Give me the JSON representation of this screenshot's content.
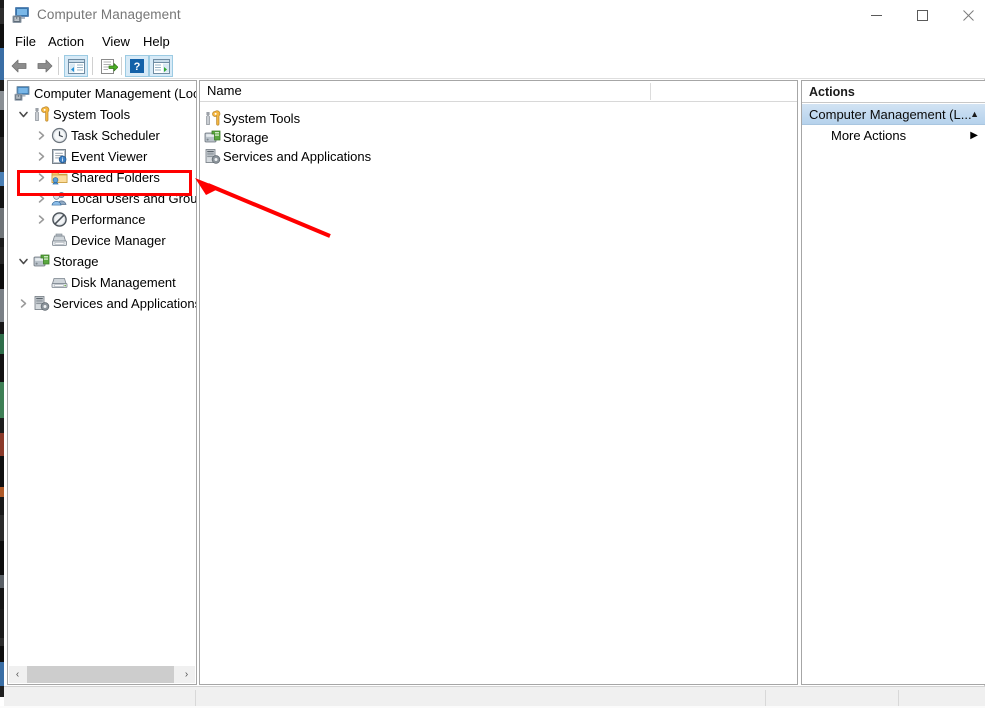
{
  "window": {
    "title": "Computer Management",
    "title_icon": "computer-management-icon",
    "controls": {
      "minimize": "—",
      "maximize": "☐",
      "close": "×"
    }
  },
  "menubar": {
    "items": [
      {
        "label": "File",
        "name": "menu-file"
      },
      {
        "label": "Action",
        "name": "menu-action"
      },
      {
        "label": "View",
        "name": "menu-view"
      },
      {
        "label": "Help",
        "name": "menu-help"
      }
    ]
  },
  "toolbar": {
    "buttons": [
      {
        "name": "back-icon",
        "glyph": "◀"
      },
      {
        "name": "forward-icon",
        "glyph": "▶"
      },
      {
        "name": "show-hide-console-tree-icon",
        "glyph": "tree"
      },
      {
        "name": "export-list-icon",
        "glyph": "export"
      },
      {
        "name": "help-icon",
        "glyph": "?"
      },
      {
        "name": "show-hide-action-pane-icon",
        "glyph": "pane"
      }
    ]
  },
  "tree": {
    "root": {
      "label": "Computer Management (Local",
      "icon": "computer-icon"
    },
    "items": [
      {
        "label": "System Tools",
        "icon": "system-tools-icon",
        "indent": 1,
        "expander": "expanded"
      },
      {
        "label": "Task Scheduler",
        "icon": "clock-icon",
        "indent": 2,
        "expander": "collapsed"
      },
      {
        "label": "Event Viewer",
        "icon": "event-viewer-icon",
        "indent": 2,
        "expander": "collapsed"
      },
      {
        "label": "Shared Folders",
        "icon": "shared-folders-icon",
        "indent": 2,
        "expander": "collapsed"
      },
      {
        "label": "Local Users and Groups",
        "icon": "users-groups-icon",
        "indent": 2,
        "expander": "collapsed"
      },
      {
        "label": "Performance",
        "icon": "performance-icon",
        "indent": 2,
        "expander": "collapsed"
      },
      {
        "label": "Device Manager",
        "icon": "device-manager-icon",
        "indent": 2,
        "expander": "none"
      },
      {
        "label": "Storage",
        "icon": "storage-icon",
        "indent": 1,
        "expander": "expanded"
      },
      {
        "label": "Disk Management",
        "icon": "disk-icon",
        "indent": 2,
        "expander": "none"
      },
      {
        "label": "Services and Applications",
        "icon": "services-icon",
        "indent": 1,
        "expander": "collapsed"
      }
    ],
    "scrollbar": {
      "left_arrow": "‹",
      "right_arrow": "›"
    }
  },
  "list": {
    "columns": [
      {
        "label": "Name"
      }
    ],
    "rows": [
      {
        "label": "System Tools",
        "icon": "system-tools-icon"
      },
      {
        "label": "Storage",
        "icon": "storage-icon"
      },
      {
        "label": "Services and Applications",
        "icon": "services-icon"
      }
    ]
  },
  "actions": {
    "header": "Actions",
    "group": {
      "label": "Computer Management (L...",
      "chevron": "▲"
    },
    "more": {
      "label": "More Actions",
      "arrow": "▶"
    }
  },
  "annotations": {
    "highlight": {
      "target": "Local Users and Groups",
      "color": "#ff0000"
    },
    "arrow": {
      "color": "#ff0000",
      "points_to": "Local Users and Groups"
    }
  },
  "statusbar": {
    "text": ""
  },
  "colors": {
    "accent_selection": "#c3daf0",
    "annotation": "#ff0000",
    "panel_border": "#a6a6a6",
    "title_text": "#767676"
  }
}
